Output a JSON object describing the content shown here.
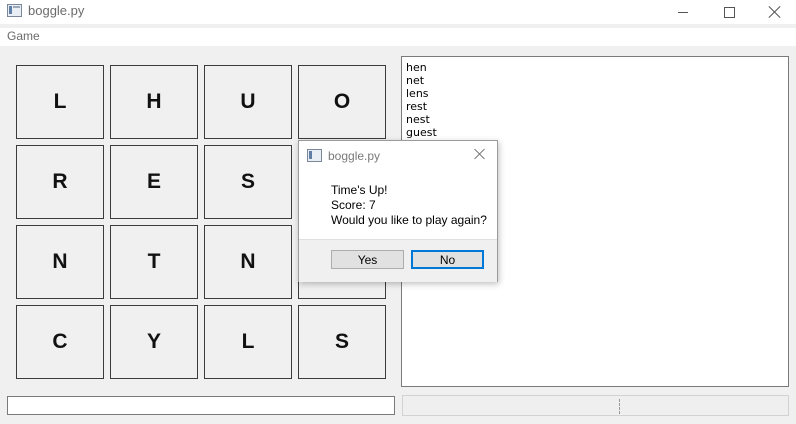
{
  "window": {
    "title": "boggle.py",
    "controls": {
      "minimize": "minimize-icon",
      "maximize": "maximize-icon",
      "close": "close-icon"
    }
  },
  "menu": {
    "game": "Game"
  },
  "board": {
    "tiles": [
      "L",
      "H",
      "U",
      "O",
      "R",
      "E",
      "S",
      "",
      "N",
      "T",
      "N",
      "",
      "C",
      "Y",
      "L",
      "S"
    ]
  },
  "word_list": [
    "hen",
    "net",
    "lens",
    "rest",
    "nest",
    "guest"
  ],
  "entry": {
    "value": ""
  },
  "dialog": {
    "title": "boggle.py",
    "line1": "Time's Up!",
    "line2": "Score: 7",
    "line3": "Would you like to play again?",
    "yes_label": "Yes",
    "no_label": "No"
  },
  "colors": {
    "focus_accent": "#0078d7",
    "background": "#f0f0f0"
  }
}
